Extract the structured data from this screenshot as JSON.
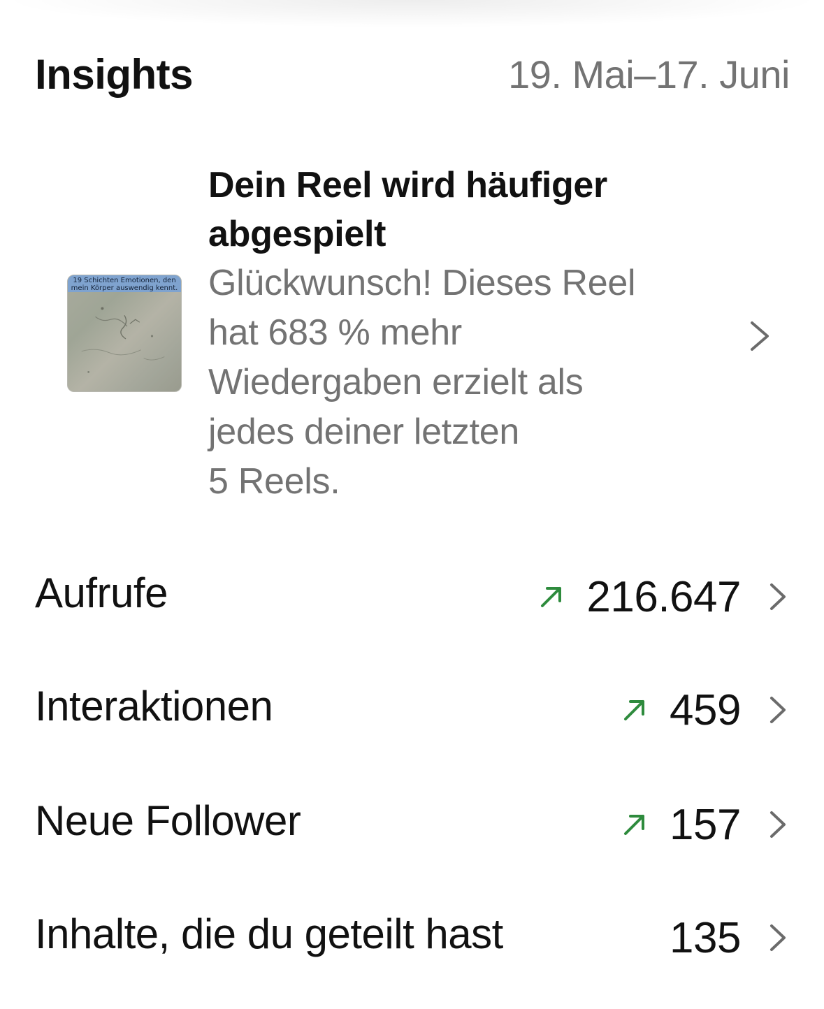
{
  "header": {
    "title": "Insights",
    "date_range": "19. Mai–17. Juni"
  },
  "highlight": {
    "title_line1": "Dein Reel wird häufiger",
    "title_line2": "abgespielt",
    "body_lines": [
      "Glückwunsch! Dieses Reel",
      "hat 683 % mehr",
      "Wiedergaben erzielt als",
      "jedes deiner letzten",
      "5 Reels."
    ],
    "thumbnail_caption_line1": "19 Schichten Emotionen, den",
    "thumbnail_caption_line2": "mein Körper auswendig kennt.",
    "chevron_icon": "chevron-right-icon"
  },
  "metrics": [
    {
      "label": "Aufrufe",
      "value": "216.647",
      "trend": "up"
    },
    {
      "label": "Interaktionen",
      "value": "459",
      "trend": "up"
    },
    {
      "label": "Neue Follower",
      "value": "157",
      "trend": "up"
    },
    {
      "label": "Inhalte, die du geteilt hast",
      "value": "135",
      "trend": "none"
    }
  ],
  "colors": {
    "trend_up": "#2e8b3d",
    "secondary_text": "#737373",
    "primary_text": "#111111",
    "chevron": "#6b6b6b"
  }
}
